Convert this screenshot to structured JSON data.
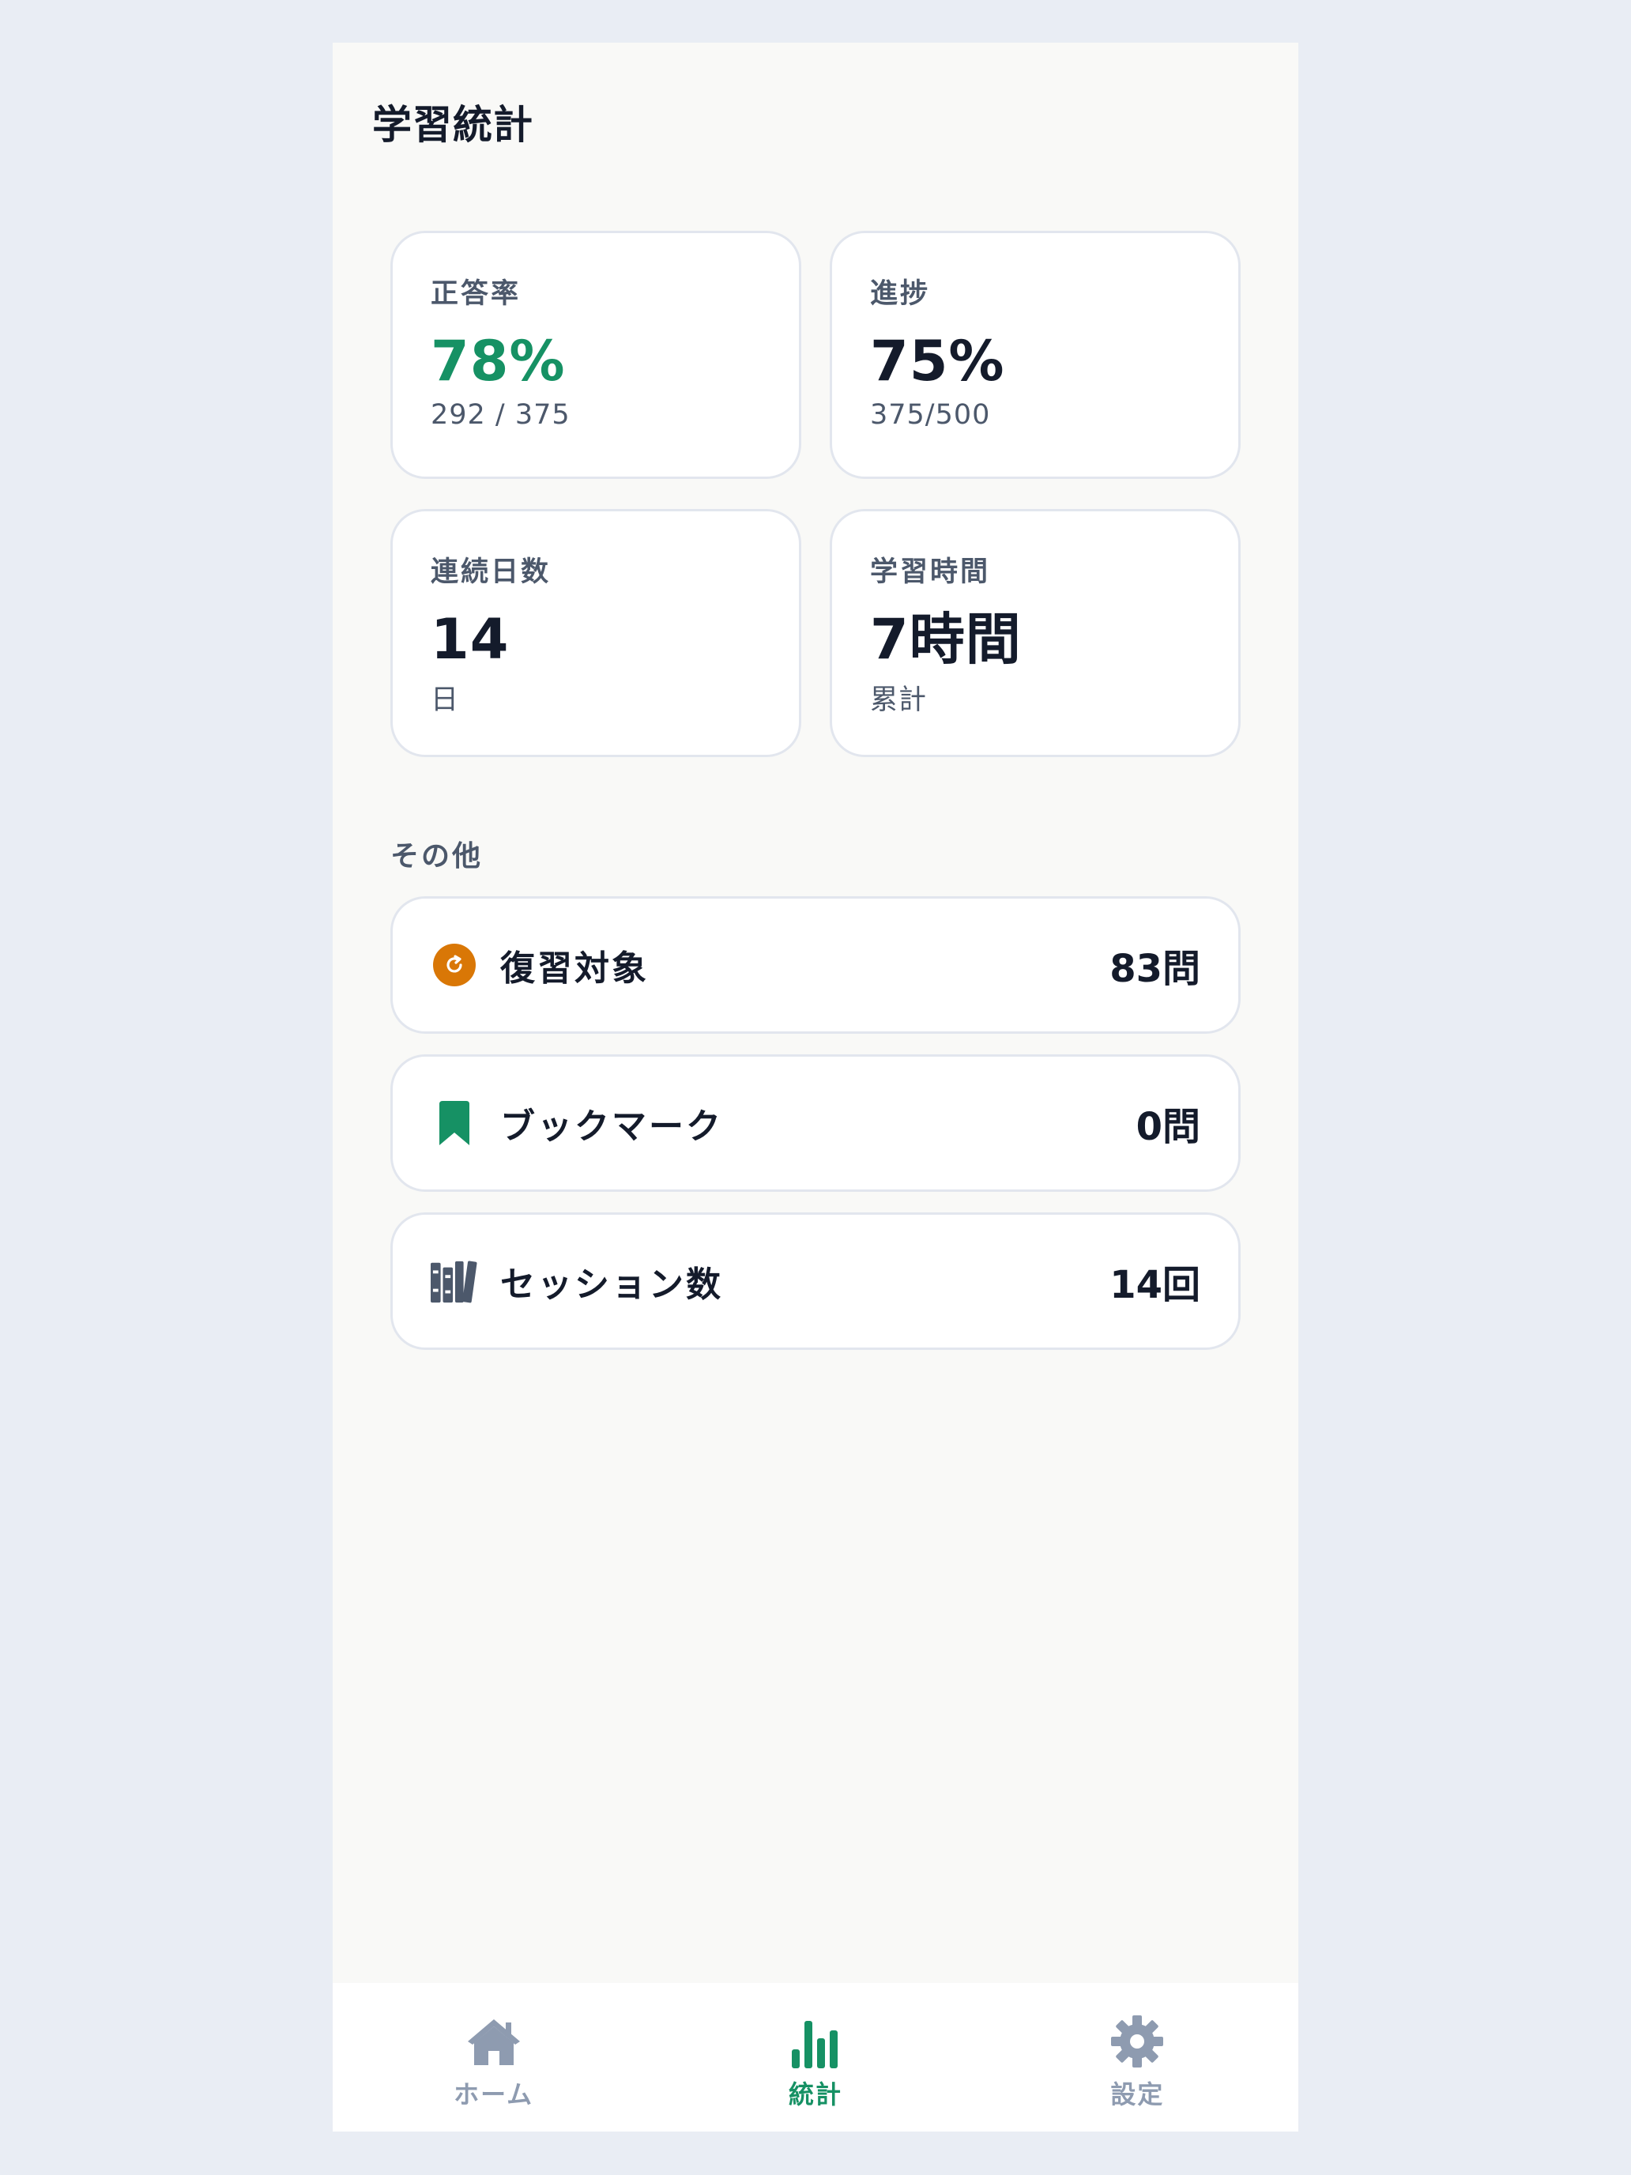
{
  "header": {
    "title": "学習統計"
  },
  "stats": [
    {
      "label": "正答率",
      "value": "78%",
      "sub": "292 / 375",
      "value_color": "#169164"
    },
    {
      "label": "進捗",
      "value": "75%",
      "sub": "375/500",
      "value_color": "#141b2b"
    },
    {
      "label": "連続日数",
      "value": "14",
      "sub": "日",
      "value_color": "#141b2b"
    },
    {
      "label": "学習時間",
      "value": "7時間",
      "sub": "累計",
      "value_color": "#141b2b"
    }
  ],
  "other": {
    "title": "その他",
    "items": [
      {
        "icon": "review-icon",
        "label": "復習対象",
        "value": "83問",
        "icon_color": "#d97706"
      },
      {
        "icon": "bookmark-icon",
        "label": "ブックマーク",
        "value": "0問",
        "icon_color": "#169164"
      },
      {
        "icon": "books-icon",
        "label": "セッション数",
        "value": "14回",
        "icon_color": "#4c586b"
      }
    ]
  },
  "tabbar": {
    "items": [
      {
        "icon": "home-icon",
        "label": "ホーム",
        "active": false
      },
      {
        "icon": "bar-chart-icon",
        "label": "統計",
        "active": true
      },
      {
        "icon": "gear-icon",
        "label": "設定",
        "active": false
      }
    ],
    "active_color": "#169164",
    "inactive_color": "#8e9bb0"
  }
}
